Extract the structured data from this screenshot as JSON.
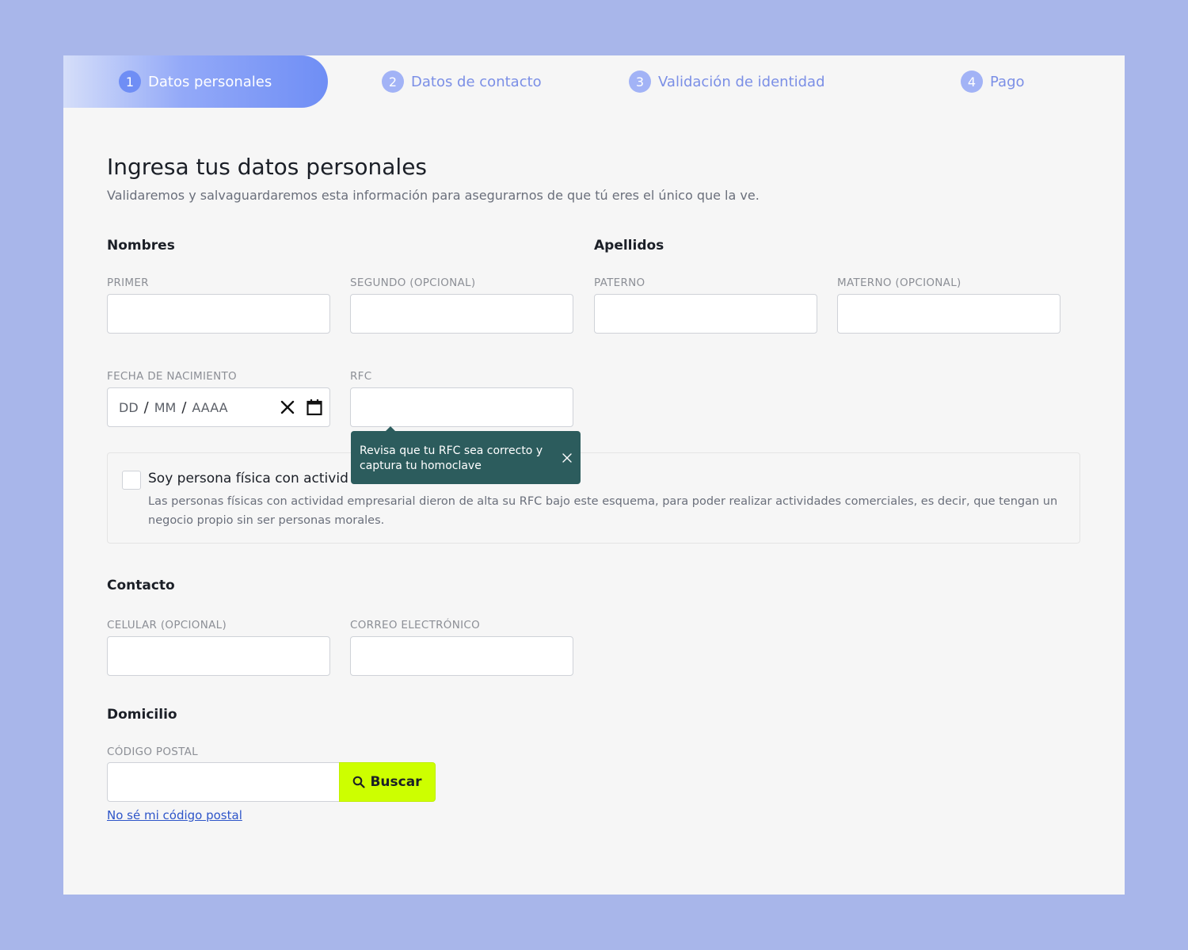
{
  "stepper": {
    "steps": [
      {
        "num": "1",
        "label": "Datos personales"
      },
      {
        "num": "2",
        "label": "Datos de contacto"
      },
      {
        "num": "3",
        "label": "Validación de identidad"
      },
      {
        "num": "4",
        "label": "Pago"
      }
    ],
    "active_step": 1
  },
  "header": {
    "title": "Ingresa tus datos personales",
    "subtitle": "Validaremos y salvaguardaremos esta información para asegurarnos de que tú eres el único que la ve."
  },
  "names": {
    "section": "Nombres",
    "first_label": "PRIMER",
    "second_label": "SEGUNDO (OPCIONAL)"
  },
  "surnames": {
    "section": "Apellidos",
    "paternal_label": "PATERNO",
    "maternal_label": "MATERNO (OPCIONAL)"
  },
  "birthdate": {
    "label": "FECHA DE NACIMIENTO",
    "day_placeholder": "DD",
    "month_placeholder": "MM",
    "year_placeholder": "AAAA",
    "separator": "/"
  },
  "rfc": {
    "label": "RFC",
    "tooltip": "Revisa que tu RFC sea correcto y captura tu homoclave"
  },
  "business_activity": {
    "checkbox_label": "Soy persona física con activid",
    "description": "Las personas físicas con actividad empresarial dieron de alta su RFC bajo este esquema, para poder realizar actividades comerciales, es decir, que tengan un negocio propio sin ser personas morales."
  },
  "contact": {
    "section": "Contacto",
    "phone_label": "CELULAR (OPCIONAL)",
    "email_label": "CORREO ELECTRÓNICO"
  },
  "address": {
    "section": "Domicilio",
    "zip_label": "CÓDIGO POSTAL",
    "search_button": "Buscar",
    "unknown_zip_link": "No sé mi código postal"
  },
  "colors": {
    "background": "#a8b6ea",
    "card": "#f6f6f6",
    "accent": "#6f8ef5",
    "tooltip": "#2c5c5d",
    "search_button": "#cdff00",
    "link": "#2e55c9"
  }
}
